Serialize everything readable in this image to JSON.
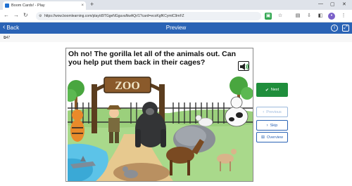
{
  "browser": {
    "tab_title": "Boom Cards! - Play",
    "url": "https://wow.boomlearning.com/play/d9TGgeNGguvaNwAQr/1?card=ecoKgfKCymtC9mFZ"
  },
  "appbar": {
    "back_label": "Back",
    "title": "Preview",
    "info_icon": "info-icon",
    "fullscreen_icon": "fullscreen-icon"
  },
  "subbar": {
    "card_count": "47"
  },
  "card": {
    "question": "Oh no! The gorilla let all of the animals out.  Can you help put them back in their cages?",
    "sign_text": "ZOO"
  },
  "buttons": {
    "next": "Next",
    "previous": "Previous",
    "skip": "Skip",
    "overview": "Overview"
  },
  "colors": {
    "appbar": "#2a63b5",
    "next": "#1f8e3c",
    "scene_grass": "#a9d98b",
    "scene_sky": "#ffffff"
  }
}
